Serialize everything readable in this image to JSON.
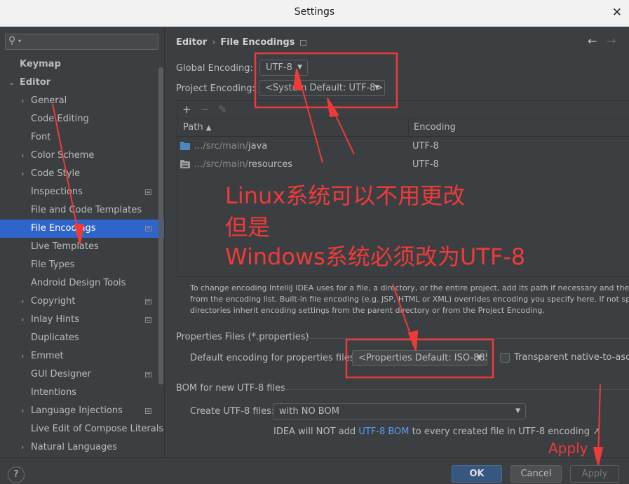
{
  "window": {
    "title": "Settings",
    "close_glyph": "✕"
  },
  "sidebar": {
    "search_placeholder": "",
    "items": [
      {
        "label": "Keymap",
        "bold": true,
        "arrow": "",
        "project": false
      },
      {
        "label": "Editor",
        "bold": true,
        "arrow": "⌄",
        "project": false
      },
      {
        "label": "General",
        "bold": false,
        "arrow": "›",
        "project": false
      },
      {
        "label": "Code Editing",
        "bold": false,
        "arrow": "",
        "project": false
      },
      {
        "label": "Font",
        "bold": false,
        "arrow": "",
        "project": false
      },
      {
        "label": "Color Scheme",
        "bold": false,
        "arrow": "›",
        "project": false
      },
      {
        "label": "Code Style",
        "bold": false,
        "arrow": "›",
        "project": false
      },
      {
        "label": "Inspections",
        "bold": false,
        "arrow": "",
        "project": true
      },
      {
        "label": "File and Code Templates",
        "bold": false,
        "arrow": "",
        "project": false
      },
      {
        "label": "File Encodings",
        "bold": false,
        "arrow": "",
        "project": true,
        "selected": true
      },
      {
        "label": "Live Templates",
        "bold": false,
        "arrow": "",
        "project": false
      },
      {
        "label": "File Types",
        "bold": false,
        "arrow": "",
        "project": false
      },
      {
        "label": "Android Design Tools",
        "bold": false,
        "arrow": "",
        "project": false
      },
      {
        "label": "Copyright",
        "bold": false,
        "arrow": "›",
        "project": true
      },
      {
        "label": "Inlay Hints",
        "bold": false,
        "arrow": "›",
        "project": true
      },
      {
        "label": "Duplicates",
        "bold": false,
        "arrow": "",
        "project": false
      },
      {
        "label": "Emmet",
        "bold": false,
        "arrow": "›",
        "project": false
      },
      {
        "label": "GUI Designer",
        "bold": false,
        "arrow": "",
        "project": true
      },
      {
        "label": "Intentions",
        "bold": false,
        "arrow": "",
        "project": false
      },
      {
        "label": "Language Injections",
        "bold": false,
        "arrow": "›",
        "project": true
      },
      {
        "label": "Live Edit of Compose Literals",
        "bold": false,
        "arrow": "",
        "project": false
      },
      {
        "label": "Natural Languages",
        "bold": false,
        "arrow": "›",
        "project": false
      }
    ]
  },
  "breadcrumb": {
    "parent": "Editor",
    "separator": "›",
    "current": "File Encodings",
    "back": "←",
    "forward": "→"
  },
  "encoding": {
    "global_label": "Global Encoding:",
    "global_value": "UTF-8",
    "project_label": "Project Encoding:",
    "project_value": "<System Default: UTF-8>"
  },
  "table_toolbar": {
    "add": "+",
    "remove": "−",
    "edit": "✎"
  },
  "table": {
    "col_path": "Path",
    "col_path_sort": "▲",
    "col_encoding": "Encoding",
    "rows": [
      {
        "prefix": ".../src/main/",
        "name": "java",
        "encoding": "UTF-8",
        "icon": "source-folder-icon"
      },
      {
        "prefix": ".../src/main/",
        "name": "resources",
        "encoding": "UTF-8",
        "icon": "resources-folder-icon"
      }
    ]
  },
  "help_text": [
    "To change encoding IntelliJ IDEA uses for a file, a directory, or the entire project, add its path if necessary and then selec",
    "from the encoding list. Built-in file encoding (e.g. JSP, HTML or XML) overrides encoding you specify here. If not specifie",
    "directories inherit encoding settings from the parent directory or from the Project Encoding."
  ],
  "properties": {
    "section": "Properties Files (*.properties)",
    "default_label": "Default encoding for properties files:",
    "default_value": "<Properties Default: ISO-885",
    "transparent_label": "Transparent native-to-ascii c",
    "transparent_checked": false
  },
  "bom": {
    "section": "BOM for new UTF-8 files",
    "create_label": "Create UTF-8 files:",
    "create_value": "with NO BOM",
    "info_before": "IDEA will NOT add",
    "info_link": "UTF-8 BOM",
    "info_after": "to every created file in UTF-8 encoding ↗"
  },
  "buttons": {
    "help": "?",
    "ok": "OK",
    "cancel": "Cancel",
    "apply": "Apply"
  },
  "annotations": {
    "line1": "Linux系统可以不用更改",
    "line2": "但是",
    "line3": "Windows系统必须改为UTF-8",
    "apply_note": "Apply",
    "color": "#f03a3a"
  },
  "colors": {
    "selection": "#2f65ca",
    "link": "#589df6",
    "ok_button": "#365880",
    "background": "#3c3f41"
  }
}
